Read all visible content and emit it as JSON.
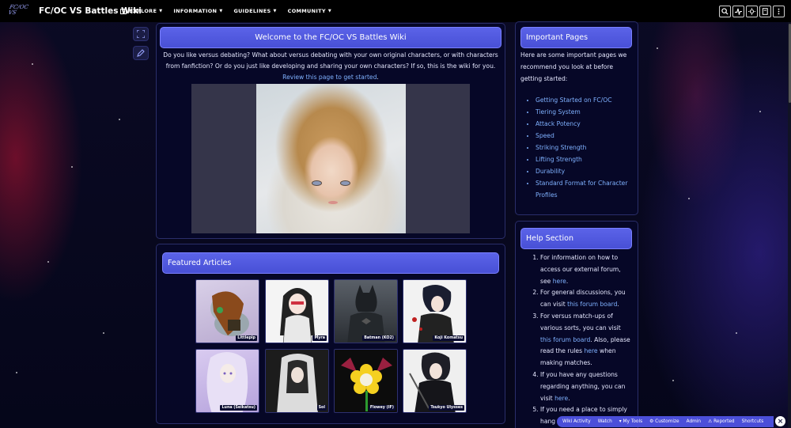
{
  "topbar": {
    "logo_text": "FC/OC VS",
    "wiki_title": "FC/OC VS Battles Wiki",
    "nav": [
      {
        "label": "EXPLORE",
        "icon": "explore-icon"
      },
      {
        "label": "INFORMATION"
      },
      {
        "label": "GUIDELINES"
      },
      {
        "label": "COMMUNITY"
      }
    ],
    "tools": [
      "search-icon",
      "activity-icon",
      "theme-toggle-icon",
      "page-icon",
      "more-icon"
    ]
  },
  "rail": [
    "fullscreen-icon",
    "edit-icon"
  ],
  "welcome": {
    "title": "Welcome to the FC/OC VS Battles Wiki",
    "intro_line1": "Do you like versus debating? What about versus debating with your own original characters, or with characters",
    "intro_line2": "from fanfiction? Or do you just like developing and sharing your own characters? If so, this is the wiki for you.",
    "intro_link": "Review this page to get started",
    "intro_link_suffix": "."
  },
  "featured": {
    "title": "Featured Articles",
    "items": [
      {
        "label": "Littlepip"
      },
      {
        "label": "Myra"
      },
      {
        "label": "Batman (KO2)"
      },
      {
        "label": "Koji Komatsu"
      },
      {
        "label": "Luna (Seikatsu)"
      },
      {
        "label": "Sol"
      },
      {
        "label": "Flowey (IF)"
      },
      {
        "label": "Tsukyo Ulysses"
      }
    ]
  },
  "important": {
    "title": "Important Pages",
    "text_lines": [
      "Here are some important pages we",
      "recommend you look at before",
      "getting started:"
    ],
    "links": [
      "Getting Started on FC/OC",
      "Tiering System",
      "Attack Potency",
      "Speed",
      "Striking Strength",
      "Lifting Strength",
      "Durability",
      "Standard Format for Character",
      "Profiles"
    ]
  },
  "help": {
    "title": "Help Section",
    "items": [
      {
        "text_a": "For information on how to",
        "text_b": "access our external forum,",
        "text_c": "see ",
        "link": "here",
        "after": "."
      },
      {
        "text_a": "For general discussions, you",
        "text_b": "can visit ",
        "link": "this forum board",
        "after": "."
      },
      {
        "text_a": "For versus match-ups of",
        "text_b": "various sorts, you can visit",
        "link": "this forum board",
        "after": ". Also, please",
        "text_c": "read the rules ",
        "link2": "here",
        "after2": " when",
        "text_d": "making matches."
      },
      {
        "text_a": "If you have any questions",
        "text_b": "regarding anything, you can",
        "text_c": "visit ",
        "link": "here",
        "after": "."
      },
      {
        "text_a": "If you need a place to simply",
        "text_b": "hang"
      }
    ]
  },
  "bottombar": {
    "items": [
      "Wiki Activity",
      "Watch",
      "My Tools",
      "Customize",
      "Admin",
      "Reported",
      "Shortcuts"
    ],
    "close": "×"
  },
  "colors": {
    "accent": "#4b4fd9",
    "link": "#7fb1ff",
    "panel": "#06082a"
  }
}
